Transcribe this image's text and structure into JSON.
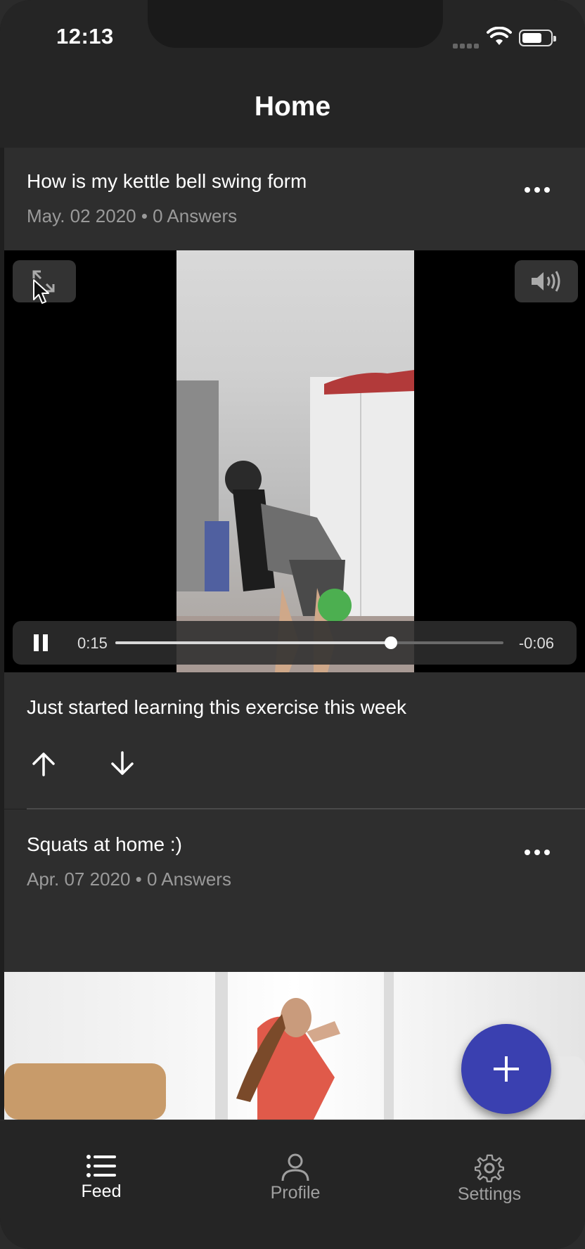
{
  "status_bar": {
    "time": "12:13"
  },
  "header": {
    "title": "Home"
  },
  "posts": [
    {
      "title": "How is my kettle bell swing form",
      "date": "May. 02 2020",
      "answers": "0 Answers",
      "meta": "May. 02 2020 • 0 Answers",
      "description": "Just started learning this exercise this week",
      "video": {
        "elapsed": "0:15",
        "remaining": "-0:06",
        "progress": 0.71,
        "state": "playing"
      }
    },
    {
      "title": "Squats at home :)",
      "date": "Apr. 07 2020",
      "answers": "0 Answers",
      "meta": "Apr. 07 2020 • 0 Answers"
    }
  ],
  "tabs": [
    {
      "label": "Feed",
      "icon": "list-icon",
      "active": true
    },
    {
      "label": "Profile",
      "icon": "person-icon",
      "active": false
    },
    {
      "label": "Settings",
      "icon": "gear-icon",
      "active": false
    }
  ],
  "colors": {
    "accent": "#3a40b0",
    "background": "#1f1f1f",
    "card": "#2e2e2e",
    "active_tab": "#ffffff",
    "inactive_tab": "#a0a0a0"
  }
}
